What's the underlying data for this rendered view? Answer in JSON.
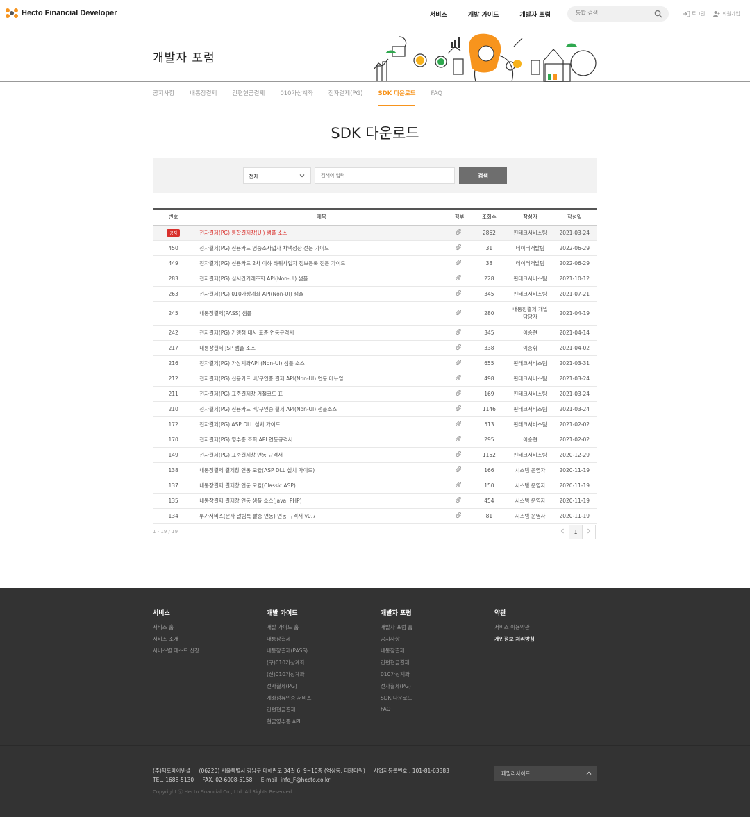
{
  "header": {
    "logo_text": "Hecto Financial Developer",
    "nav": [
      "서비스",
      "개발 가이드",
      "개발자 포럼"
    ],
    "search_placeholder": "통합 검색",
    "login": "로그인",
    "signup": "회원가입"
  },
  "hero": {
    "title": "개발자 포럼"
  },
  "tabs": [
    {
      "label": "공지사항",
      "active": false
    },
    {
      "label": "내통장결제",
      "active": false
    },
    {
      "label": "간편현금결제",
      "active": false
    },
    {
      "label": "010가상계좌",
      "active": false
    },
    {
      "label": "전자결제(PG)",
      "active": false
    },
    {
      "label": "SDK 다운로드",
      "active": true
    },
    {
      "label": "FAQ",
      "active": false
    }
  ],
  "page_title": "SDK 다운로드",
  "filter": {
    "select_value": "전체",
    "keyword_placeholder": "검색어 입력",
    "search_label": "검색"
  },
  "table": {
    "headers": [
      "번호",
      "제목",
      "첨부",
      "조회수",
      "작성자",
      "작성일"
    ],
    "notice_badge": "공지",
    "rows": [
      {
        "no": "",
        "notice": true,
        "title": "전자결제(PG) 통합결제창(UI) 샘플 소스",
        "views": "2862",
        "author": "핀테크서비스팀",
        "date": "2021-03-24"
      },
      {
        "no": "450",
        "title": "전자결제(PG) 신용카드 영중소사업자 차액정산 전문 가이드",
        "views": "31",
        "author": "데이터개발팀",
        "date": "2022-06-29"
      },
      {
        "no": "449",
        "title": "전자결제(PG) 신용카드 2차 이하 하위사업자 정보등록 전문 가이드",
        "views": "38",
        "author": "데이터개발팀",
        "date": "2022-06-29"
      },
      {
        "no": "283",
        "title": "전자결제(PG) 실시간거래조회 API(Non-UI) 샘플",
        "views": "228",
        "author": "핀테크서비스팀",
        "date": "2021-10-12"
      },
      {
        "no": "263",
        "title": "전자결제(PG) 010가상계좌 API(Non-UI) 샘플",
        "views": "345",
        "author": "핀테크서비스팀",
        "date": "2021-07-21"
      },
      {
        "no": "245",
        "title": "내통장결제(PASS) 샘플",
        "views": "280",
        "author": "내통장결제 개발",
        "author2": "담당자",
        "date": "2021-04-19"
      },
      {
        "no": "242",
        "title": "전자결제(PG) 가맹점 대사 표준 연동규격서",
        "views": "345",
        "author": "이승현",
        "date": "2021-04-14"
      },
      {
        "no": "217",
        "title": "내통장결제 JSP 샘플 소스",
        "views": "338",
        "author": "이종휘",
        "date": "2021-04-02"
      },
      {
        "no": "216",
        "title": "전자결제(PG) 가상계좌API (Non-UI) 샘플 소스",
        "views": "655",
        "author": "핀테크서비스팀",
        "date": "2021-03-31"
      },
      {
        "no": "212",
        "title": "전자결제(PG) 신용카드 비/구인증 결제 API(Non-UI) 연동 메뉴얼",
        "views": "498",
        "author": "핀테크서비스팀",
        "date": "2021-03-24"
      },
      {
        "no": "211",
        "title": "전자결제(PG) 표준결제창 거절코드 표",
        "views": "169",
        "author": "핀테크서비스팀",
        "date": "2021-03-24"
      },
      {
        "no": "210",
        "title": "전자결제(PG) 신용카드 비/구인증 결제 API(Non-UI) 샘플소스",
        "views": "1146",
        "author": "핀테크서비스팀",
        "date": "2021-03-24"
      },
      {
        "no": "172",
        "title": "전자결제(PG) ASP DLL 설치 가이드",
        "views": "513",
        "author": "핀테크서비스팀",
        "date": "2021-02-02"
      },
      {
        "no": "170",
        "title": "전자결제(PG) 영수증 조회 API 연동규격서",
        "views": "295",
        "author": "이승현",
        "date": "2021-02-02"
      },
      {
        "no": "149",
        "title": "전자결제(PG) 표준결제창 연동 규격서",
        "views": "1152",
        "author": "핀테크서비스팀",
        "date": "2020-12-29"
      },
      {
        "no": "138",
        "title": "내통장결제 결제창 연동 모듈(ASP DLL 설치 가이드)",
        "views": "166",
        "author": "시스템 운영자",
        "date": "2020-11-19"
      },
      {
        "no": "137",
        "title": "내통장결제 결제창 연동 모듈(Classic ASP)",
        "views": "150",
        "author": "시스템 운영자",
        "date": "2020-11-19"
      },
      {
        "no": "135",
        "title": "내통장결제 결제창 연동 샘플 소스(Java, PHP)",
        "views": "454",
        "author": "시스템 운영자",
        "date": "2020-11-19"
      },
      {
        "no": "134",
        "title": "부가서비스(문자 알림톡 발송 연동) 연동 규격서 v0.7",
        "views": "81",
        "author": "시스템 운영자",
        "date": "2020-11-19"
      }
    ]
  },
  "pagination": {
    "count": "1 - 19 / 19",
    "current": "1"
  },
  "footer": {
    "columns": [
      {
        "title": "서비스",
        "links": [
          "서비스 홈",
          "서비스 소개",
          "서비스별 테스트 신청"
        ]
      },
      {
        "title": "개발 가이드",
        "links": [
          "개발 가이드 홈",
          "내통장결제",
          "내통장결제(PASS)",
          "(구)010가상계좌",
          "(신)010가상계좌",
          "전자결제(PG)",
          "계좌점유인증 서비스",
          "간편현금결제",
          "현금영수증 API"
        ]
      },
      {
        "title": "개발자 포럼",
        "links": [
          "개발자 포럼 홈",
          "공지사항",
          "내통장결제",
          "간편현금결제",
          "010가상계좌",
          "전자결제(PG)",
          "SDK 다운로드",
          "FAQ"
        ]
      },
      {
        "title": "약관",
        "links": [
          "서비스 이용약관",
          "개인정보 처리방침"
        ]
      }
    ],
    "company": "(주)헥토파이낸셜",
    "address": "(06220) 서울특별시 강남구 테헤란로 34길 6, 9~10층 (역삼동, 태광타워)",
    "biz_no": "사업자등록번호 : 101-81-63383",
    "tel": "TEL. 1688-5130",
    "fax": "FAX. 02-6008-5158",
    "email": "E-mail. info_F@hecto.co.kr",
    "copyright": "Copyright ⓒ Hecto Financial Co., Ltd. All Rights Reserved.",
    "family_site": "패밀리사이트"
  },
  "colors": {
    "accent": "#f7941d",
    "notice": "#d9302c",
    "footer_bg": "#333333"
  }
}
